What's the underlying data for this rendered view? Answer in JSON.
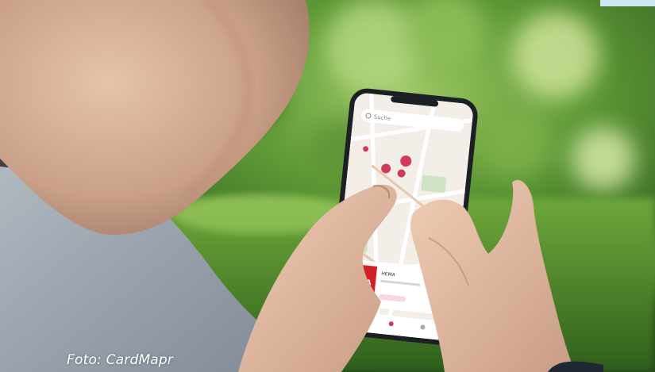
{
  "photo": {
    "subject": "person-holding-phone-with-map-app",
    "icon": "photo-icon"
  },
  "phone_screen": {
    "search_text": "Suche",
    "store_logo": "HEMA",
    "store_name": "HEMA"
  },
  "caption": {
    "credit": "Foto:  CardMapr"
  },
  "colors": {
    "accent": "#cfe7f2",
    "foliage": "#3f7a2c",
    "grass": "#4a8a2a",
    "sweater": "#9aa3ad",
    "skin": "#d9b29a",
    "phone_frame": "#1c1f24",
    "map_bg": "#f3efe8",
    "map_pin": "#d23a5a",
    "hema_red": "#d11f2c"
  }
}
